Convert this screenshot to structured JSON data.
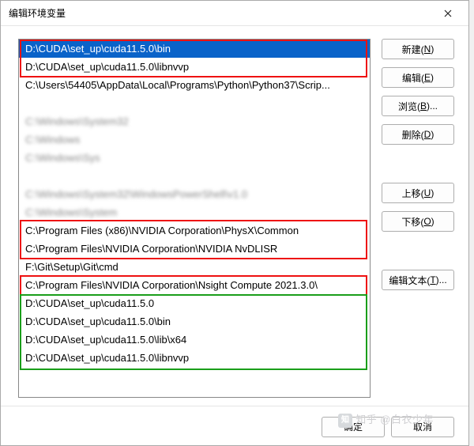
{
  "window": {
    "title": "编辑环境变量"
  },
  "rows": [
    {
      "text": "D:\\CUDA\\set_up\\cuda11.5.0\\bin",
      "cls": "selected"
    },
    {
      "text": "D:\\CUDA\\set_up\\cuda11.5.0\\libnvvp",
      "cls": ""
    },
    {
      "text": "C:\\Users\\54405\\AppData\\Local\\Programs\\Python\\Python37\\Scrip...",
      "cls": ""
    },
    {
      "text": "",
      "cls": ""
    },
    {
      "text": "C:\\Windows\\System32",
      "cls": "blur"
    },
    {
      "text": "C:\\Windows",
      "cls": "blur"
    },
    {
      "text": "C:\\Windows\\Sys",
      "cls": "blur"
    },
    {
      "text": "",
      "cls": ""
    },
    {
      "text": "C:\\Windows\\System32\\WindowsPowerShell\\v1.0",
      "cls": "blur"
    },
    {
      "text": "C:\\Windows\\System",
      "cls": "blur"
    },
    {
      "text": "C:\\Program Files (x86)\\NVIDIA Corporation\\PhysX\\Common",
      "cls": ""
    },
    {
      "text": "C:\\Program Files\\NVIDIA Corporation\\NVIDIA NvDLISR",
      "cls": ""
    },
    {
      "text": "F:\\Git\\Setup\\Git\\cmd",
      "cls": ""
    },
    {
      "text": "C:\\Program Files\\NVIDIA Corporation\\Nsight Compute 2021.3.0\\",
      "cls": ""
    },
    {
      "text": "D:\\CUDA\\set_up\\cuda11.5.0",
      "cls": ""
    },
    {
      "text": "D:\\CUDA\\set_up\\cuda11.5.0\\bin",
      "cls": ""
    },
    {
      "text": "D:\\CUDA\\set_up\\cuda11.5.0\\lib\\x64",
      "cls": ""
    },
    {
      "text": "D:\\CUDA\\set_up\\cuda11.5.0\\libnvvp",
      "cls": ""
    }
  ],
  "buttons": {
    "new": {
      "label": "新建(",
      "key": "N",
      "tail": ")"
    },
    "edit": {
      "label": "编辑(",
      "key": "E",
      "tail": ")"
    },
    "browse": {
      "label": "浏览(",
      "key": "B",
      "tail": ")..."
    },
    "delete": {
      "label": "删除(",
      "key": "D",
      "tail": ")"
    },
    "up": {
      "label": "上移(",
      "key": "U",
      "tail": ")"
    },
    "down": {
      "label": "下移(",
      "key": "O",
      "tail": ")"
    },
    "edittext": {
      "label": "编辑文本(",
      "key": "T",
      "tail": ")..."
    }
  },
  "footer": {
    "ok": "确定",
    "cancel": "取消"
  },
  "watermark": "知乎 @白衣少年"
}
